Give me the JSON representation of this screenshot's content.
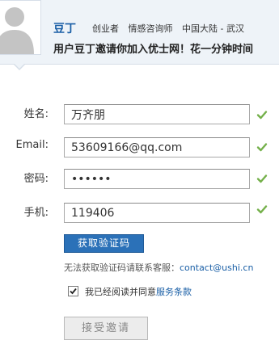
{
  "header": {
    "inviter_name": "豆丁",
    "tags": [
      "创业者",
      "情感咨询师",
      "中国大陆 - 武汉"
    ],
    "invite_message": "用户豆丁邀请你加入优士网！花一分钟时间"
  },
  "form": {
    "name_label": "姓名:",
    "name_value": "万齐朋",
    "email_label": "Email:",
    "email_value": "53609166@qq.com",
    "password_label": "密码:",
    "password_value": "••••••",
    "phone_label": "手机:",
    "phone_value": "119406"
  },
  "get_code_label": "获取验证码",
  "help": {
    "text": "无法获取验证码请联系客服：",
    "email": "contact@ushi.cn"
  },
  "agreement": {
    "text": "我已经阅读并同意",
    "link": "服务条款",
    "checked": true
  },
  "accept_label": "接受邀请",
  "colors": {
    "brand_blue": "#1a5fa6",
    "button_blue": "#2b71b8",
    "check_green": "#74b04a"
  },
  "icons": {
    "avatar": "user-silhouette",
    "valid": "check-icon"
  }
}
